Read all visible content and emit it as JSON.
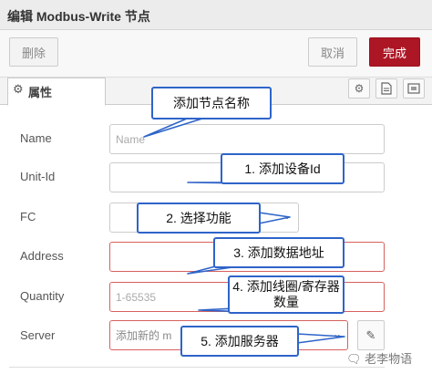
{
  "header": {
    "title": "编辑 Modbus-Write 节点"
  },
  "toolbar": {
    "delete_label": "删除",
    "cancel_label": "取消",
    "done_label": "完成"
  },
  "tabs": {
    "properties_label": "属性",
    "properties_icon": "gear-icon"
  },
  "form": {
    "name": {
      "label": "Name",
      "placeholder": "Name"
    },
    "unit_id": {
      "label": "Unit-Id",
      "value": ""
    },
    "fc": {
      "label": "FC",
      "value": ""
    },
    "address": {
      "label": "Address",
      "value": ""
    },
    "quantity": {
      "label": "Quantity",
      "placeholder": "1-65535"
    },
    "server": {
      "label": "Server",
      "value": "添加新的 m"
    }
  },
  "callouts": {
    "name": "添加节点名称",
    "unit_id": "1. 添加设备Id",
    "fc": "2. 选择功能",
    "address": "3. 添加数据地址",
    "quantity": "4. 添加线圈/寄存器数量",
    "server": "5. 添加服务器"
  },
  "watermark": "老李物语",
  "colors": {
    "callout_border": "#2e64c9",
    "done_button": "#ad1625",
    "error_border": "#d6615e"
  }
}
